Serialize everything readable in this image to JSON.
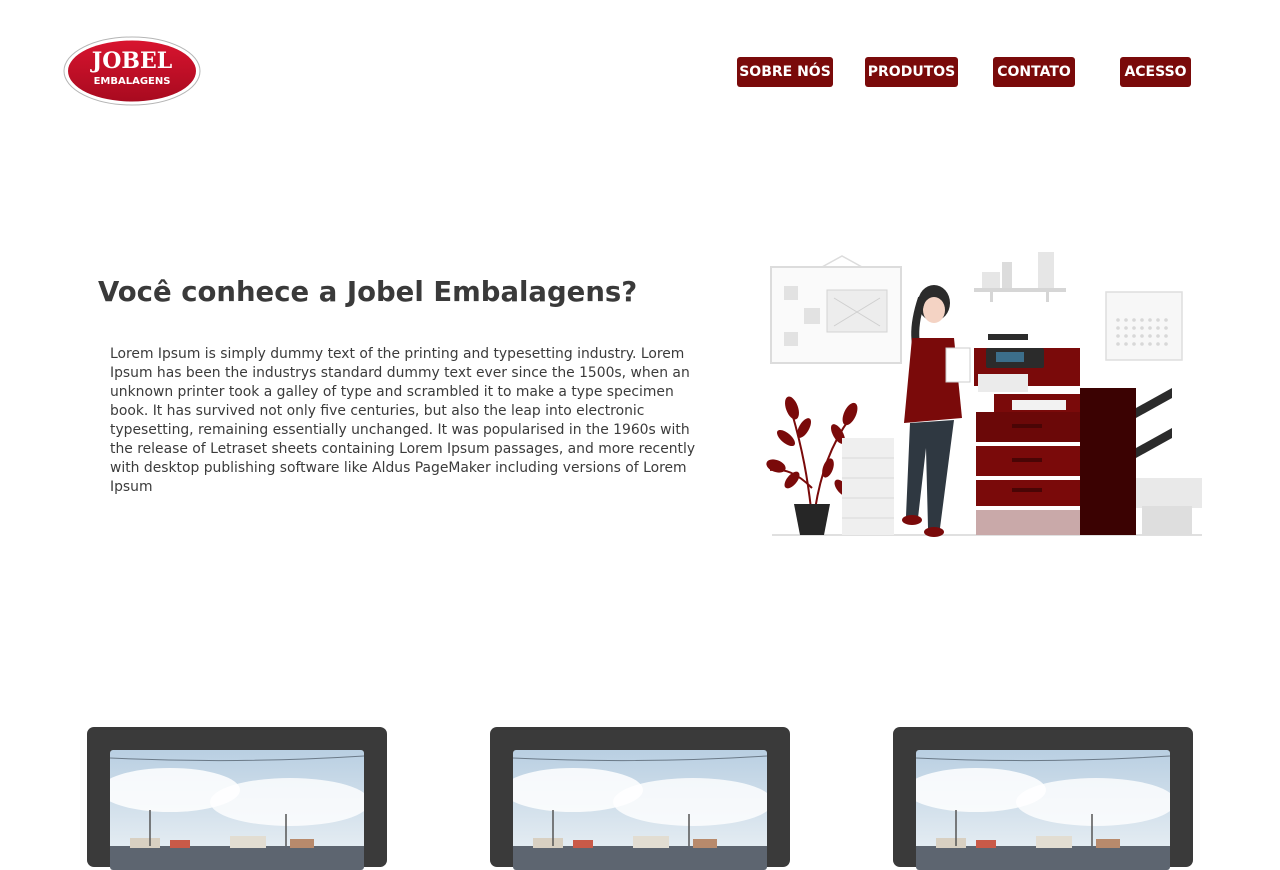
{
  "brand": {
    "logo_line1": "JOBEL",
    "logo_line2": "EMBALAGENS",
    "primary_color": "#7a0a0a",
    "logo_color": "#c8102e"
  },
  "nav": {
    "items": [
      {
        "label": "SOBRE NÓS"
      },
      {
        "label": "PRODUTOS"
      },
      {
        "label": "CONTATO"
      },
      {
        "label": "ACESSO"
      }
    ]
  },
  "hero": {
    "title": "Você conhece a Jobel Embalagens?",
    "body": "Lorem Ipsum is simply dummy text of the printing and typesetting industry. Lorem Ipsum has been the industrys standard dummy text ever since the 1500s, when an unknown printer took a galley of type and scrambled it to make a type specimen book. It has survived not only five centuries, but also the leap into electronic typesetting, remaining essentially unchanged. It was popularised in the 1960s with the release of Letraset sheets containing Lorem Ipsum passages, and more recently with desktop publishing software like Aldus PageMaker including versions of Lorem Ipsum"
  },
  "cards": [
    {
      "image": "city-skyline-photo"
    },
    {
      "image": "city-skyline-photo"
    },
    {
      "image": "city-skyline-photo"
    }
  ]
}
